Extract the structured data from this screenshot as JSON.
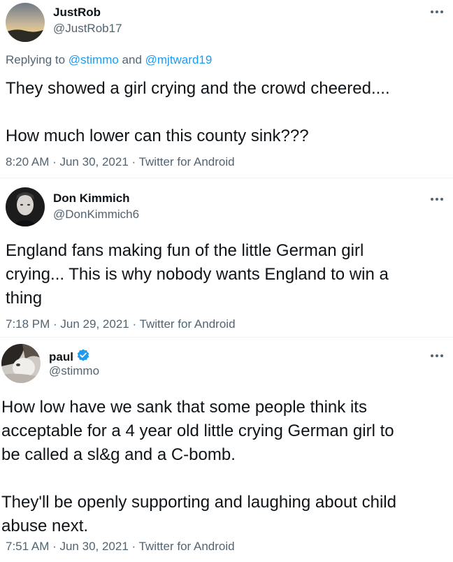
{
  "tweets": [
    {
      "name": "JustRob",
      "handle": "@JustRob17",
      "reply_prefix": "Replying to ",
      "reply_user1": "@stimmo",
      "reply_and": " and ",
      "reply_user2": "@mjtward19",
      "text": "They showed a girl crying and the crowd cheered....\n\nHow much lower can this county sink???",
      "meta": "8:20 AM · Jun 30, 2021 · Twitter for Android"
    },
    {
      "name": "Don Kimmich",
      "handle": "@DonKimmich6",
      "text": "England fans making fun of the little German girl\ncrying... This is why nobody wants England to win a\nthing",
      "meta": "7:18 PM · Jun 29, 2021 · Twitter for Android"
    },
    {
      "name": "paul",
      "handle": "@stimmo",
      "verified": true,
      "text": "How low have we sank that some people think its\nacceptable for a 4 year old little crying German girl to\nbe called a sl&g and a C-bomb.\n\nThey'll be openly supporting and laughing about child\nabuse next.",
      "meta": "7:51 AM · Jun 30, 2021 · Twitter for Android"
    }
  ],
  "colors": {
    "text": "#0f1419",
    "secondary": "#536471",
    "link": "#1d9bf0",
    "verified": "#1d9bf0"
  }
}
